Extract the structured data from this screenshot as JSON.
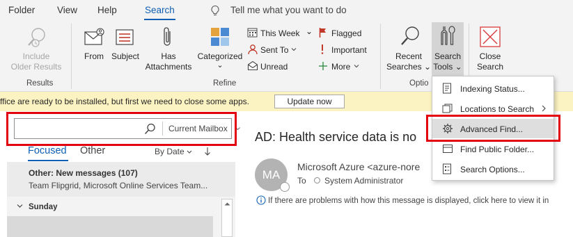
{
  "tabs": [
    {
      "label": "Folder"
    },
    {
      "label": "View"
    },
    {
      "label": "Help"
    },
    {
      "label": "Search"
    }
  ],
  "tell_me": {
    "text": "Tell me what you want to do"
  },
  "ribbon": {
    "results": {
      "include_line1": "Include",
      "include_line2": "Older Results",
      "group_label": "Results"
    },
    "refine": {
      "from": "From",
      "subject": "Subject",
      "has_line1": "Has",
      "has_line2": "Attachments",
      "categorized": "Categorized",
      "categorized_chev": "⌄",
      "this_week": "This Week",
      "this_week_chev": "⌄",
      "sent_to": "Sent To",
      "unread": "Unread",
      "flagged": "Flagged",
      "important": "Important",
      "more": "More",
      "group_label": "Refine"
    },
    "options": {
      "recent_line1": "Recent",
      "recent_line2": "Searches ⌄",
      "tools_line1": "Search",
      "tools_line2": "Tools ⌄",
      "close_line1": "Close",
      "close_line2": "Search",
      "group_label": "Optio"
    }
  },
  "notification": {
    "text": "ffice are ready to be installed, but first we need to close some apps.",
    "button": "Update now"
  },
  "search": {
    "placeholder": "",
    "scope": "Current Mailbox"
  },
  "message_list": {
    "focused_tab": "Focused",
    "other_tab": "Other",
    "sort_label": "By Date",
    "group": {
      "title": "Other: New messages (107)",
      "subtitle": "Team Flipgrid, Microsoft Online Services Team..."
    },
    "day_header": "Sunday"
  },
  "reading_pane": {
    "subject": "AD: Health service data is no",
    "avatar_initials": "MA",
    "sender": "Microsoft Azure <azure-nore",
    "to_label": "To",
    "to_name": "System Administrator",
    "info_text": "If there are problems with how this message is displayed, click here to view it in"
  },
  "search_tools_menu": {
    "items": [
      {
        "label": "Indexing Status..."
      },
      {
        "label": "Locations to Search"
      },
      {
        "label": "Advanced Find..."
      },
      {
        "label": "Find Public Folder..."
      },
      {
        "label": "Search Options..."
      }
    ]
  },
  "colors": {
    "accent": "#0f5fb5",
    "highlight_box": "#e3000f",
    "notification_bg": "#fcf3c2",
    "ribbon_bg": "#f3f3f3"
  }
}
